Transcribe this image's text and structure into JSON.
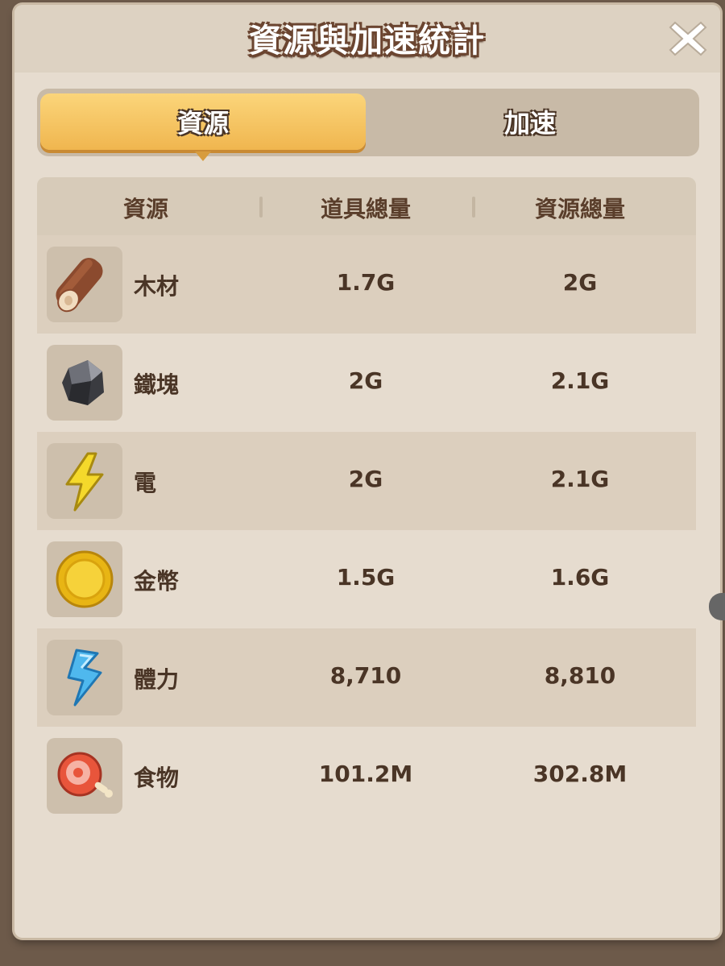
{
  "window": {
    "title": "資源與加速統計"
  },
  "tabs": [
    {
      "label": "資源",
      "active": true
    },
    {
      "label": "加速",
      "active": false
    }
  ],
  "table": {
    "headers": [
      "資源",
      "道具總量",
      "資源總量"
    ],
    "rows": [
      {
        "name": "木材",
        "item_total": "1.7G",
        "resource_total": "2G",
        "icon": "wood-log-icon"
      },
      {
        "name": "鐵塊",
        "item_total": "2G",
        "resource_total": "2.1G",
        "icon": "iron-ore-icon"
      },
      {
        "name": "電",
        "item_total": "2G",
        "resource_total": "2.1G",
        "icon": "lightning-icon"
      },
      {
        "name": "金幣",
        "item_total": "1.5G",
        "resource_total": "1.6G",
        "icon": "gold-coin-icon"
      },
      {
        "name": "體力",
        "item_total": "8,710",
        "resource_total": "8,810",
        "icon": "stamina-bolt-icon"
      },
      {
        "name": "食物",
        "item_total": "101.2M",
        "resource_total": "302.8M",
        "icon": "meat-icon"
      }
    ]
  },
  "colors": {
    "panel_bg": "#e6dccf",
    "tab_active": "#f5c15e",
    "text_dark": "#4a3526",
    "title_outline": "#6b4530"
  }
}
